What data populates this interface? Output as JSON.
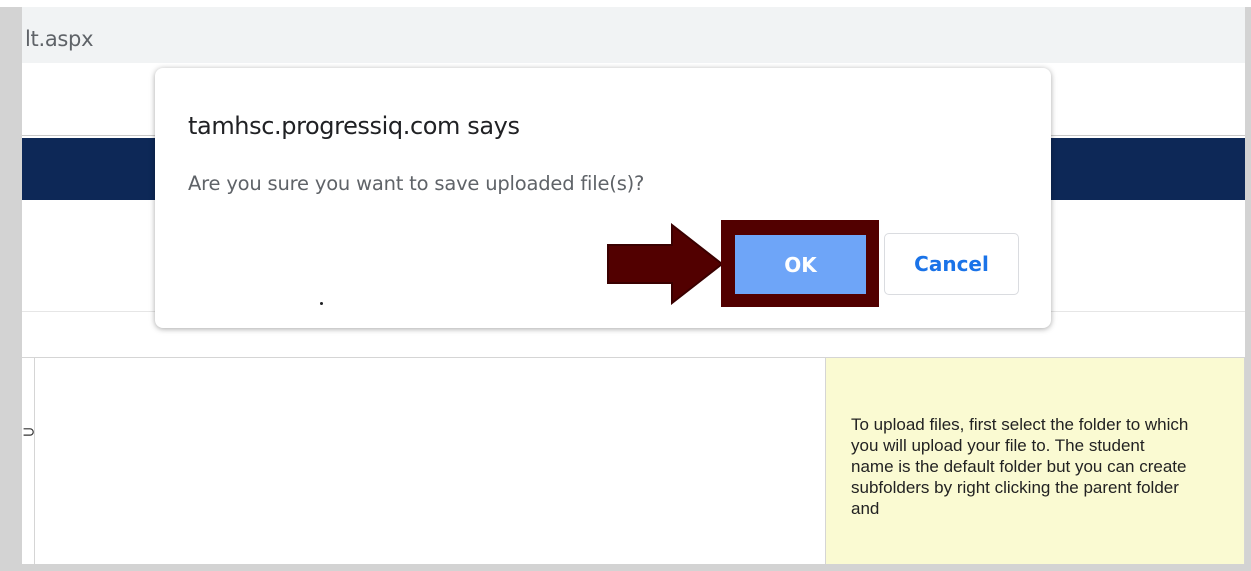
{
  "browser": {
    "address_text": "lt.aspx"
  },
  "dialog": {
    "title": "tamhsc.progressiq.com says",
    "message": "Are you sure you want to save uploaded file(s)?",
    "ok_label": "OK",
    "cancel_label": "Cancel"
  },
  "help_panel": {
    "text": "To upload files, first select the folder to which you will upload your file to. The student name is the default folder but you can create subfolders by right clicking the parent folder and"
  },
  "colors": {
    "nav_band": "#0d2857",
    "ok_button": "#6ea5f8",
    "highlight": "#520000",
    "help_panel_bg": "#fafad2"
  },
  "icons": {
    "annotation": "right-arrow-icon"
  }
}
